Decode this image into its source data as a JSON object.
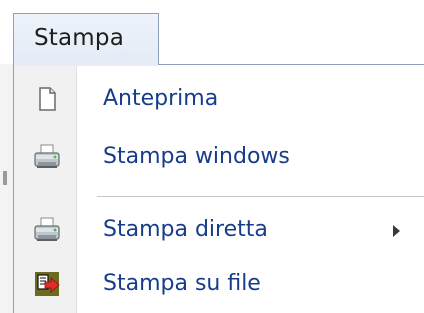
{
  "menu": {
    "title": "Stampa",
    "items": [
      {
        "label": "Anteprima",
        "icon": "document-icon"
      },
      {
        "label": "Stampa windows",
        "icon": "printer-icon"
      },
      {
        "label": "Stampa diretta",
        "icon": "printer-icon",
        "has_submenu": true
      },
      {
        "label": "Stampa su file",
        "icon": "export-file-icon"
      }
    ]
  },
  "colors": {
    "item_text": "#173d8a",
    "border": "#8e9fb8",
    "gutter": "#f1f1f1"
  }
}
